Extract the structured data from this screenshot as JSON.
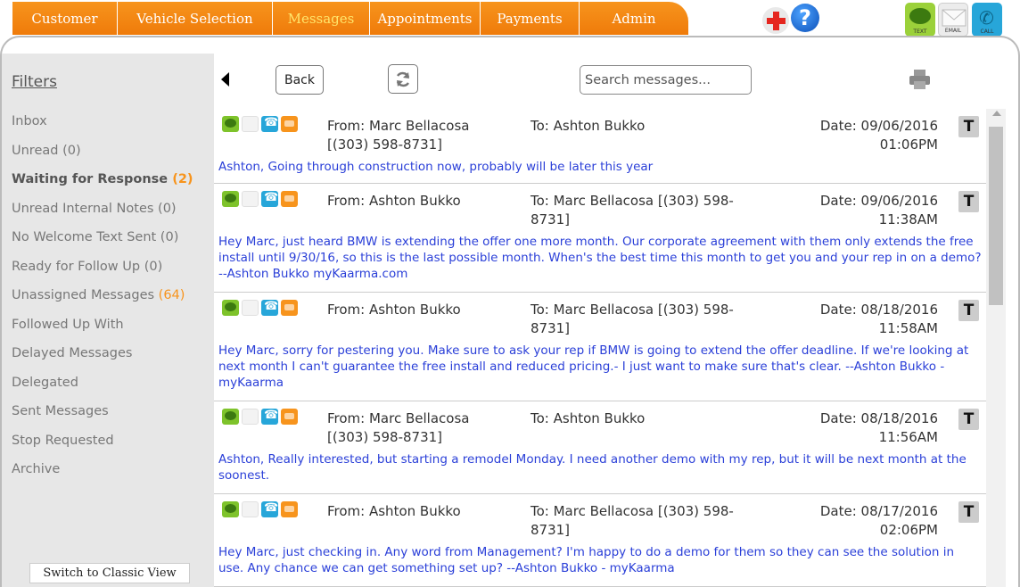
{
  "nav": {
    "tabs": [
      {
        "label": "Customer",
        "active": false
      },
      {
        "label": "Vehicle Selection",
        "active": false
      },
      {
        "label": "Messages",
        "active": true
      },
      {
        "label": "Appointments",
        "active": false
      },
      {
        "label": "Payments",
        "active": false
      },
      {
        "label": "Admin",
        "active": false
      }
    ],
    "tab_color": "#f7941d",
    "active_tab_text_color": "#ffe56b"
  },
  "top_icons": {
    "help_glyph": "?",
    "icons": [
      "red-cross-icon",
      "help-icon"
    ],
    "channel_buttons": [
      {
        "name": "text-button",
        "caption": "TEXT"
      },
      {
        "name": "email-button",
        "caption": "EMAIL"
      },
      {
        "name": "call-button",
        "caption": "CALL"
      }
    ]
  },
  "sidebar": {
    "title": "Filters",
    "items": [
      {
        "label": "Inbox",
        "count": ""
      },
      {
        "label": "Unread (0)",
        "count": ""
      },
      {
        "label": "Waiting for Response",
        "count": "(2)",
        "bold": true
      },
      {
        "label": "Unread Internal Notes (0)",
        "count": ""
      },
      {
        "label": "No Welcome Text Sent (0)",
        "count": ""
      },
      {
        "label": "Ready for Follow Up (0)",
        "count": ""
      },
      {
        "label": "Unassigned Messages",
        "count": "(64)"
      },
      {
        "label": "Followed Up With",
        "count": ""
      },
      {
        "label": "Delayed Messages",
        "count": ""
      },
      {
        "label": "Delegated",
        "count": ""
      },
      {
        "label": "Sent Messages",
        "count": ""
      },
      {
        "label": "Stop Requested",
        "count": ""
      },
      {
        "label": "Archive",
        "count": ""
      }
    ],
    "classic_view_label": "Switch to Classic View"
  },
  "toolbar": {
    "back_label": "Back",
    "search_placeholder": "Search messages...",
    "search_value": ""
  },
  "messages": [
    {
      "from": "From: Marc Bellacosa [(303) 598-8731]",
      "to": "To: Ashton Bukko",
      "date": "Date: 09/06/2016",
      "time": "01:06PM",
      "badge": "T",
      "body": "Ashton, Going through construction now, probably will be later this year"
    },
    {
      "from": "From: Ashton Bukko",
      "to": "To: Marc Bellacosa [(303) 598-8731]",
      "date": "Date: 09/06/2016",
      "time": "11:38AM",
      "badge": "T",
      "body": "Hey Marc, just heard BMW is extending the offer one more month. Our corporate agreement with them only extends the free install until 9/30/16, so this is the last possible month. When's the best time this month to get you and your rep in on a demo?  --Ashton Bukko myKaarma.com"
    },
    {
      "from": "From: Ashton Bukko",
      "to": "To: Marc Bellacosa [(303) 598-8731]",
      "date": "Date: 08/18/2016",
      "time": "11:58AM",
      "badge": "T",
      "body": "Hey Marc, sorry for pestering you. Make sure to ask your rep if BMW is going to extend the offer deadline. If we're looking at next month I can't guarantee the free install and reduced pricing.- I just want to make sure that's clear.  --Ashton Bukko - myKaarma"
    },
    {
      "from": "From: Marc Bellacosa [(303) 598-8731]",
      "to": "To: Ashton Bukko",
      "date": "Date: 08/18/2016",
      "time": "11:56AM",
      "badge": "T",
      "body": "Ashton, Really interested, but starting a remodel Monday. I need another demo with my rep, but it will be next month at the soonest."
    },
    {
      "from": "From: Ashton Bukko",
      "to": "To: Marc Bellacosa [(303) 598-8731]",
      "date": "Date: 08/17/2016",
      "time": "02:06PM",
      "badge": "T",
      "body": "Hey Marc, just checking in. Any word from Management? I'm happy to do a demo for them so they can see the solution in use. Any chance we can get something set up? --Ashton Bukko - myKaarma"
    }
  ]
}
